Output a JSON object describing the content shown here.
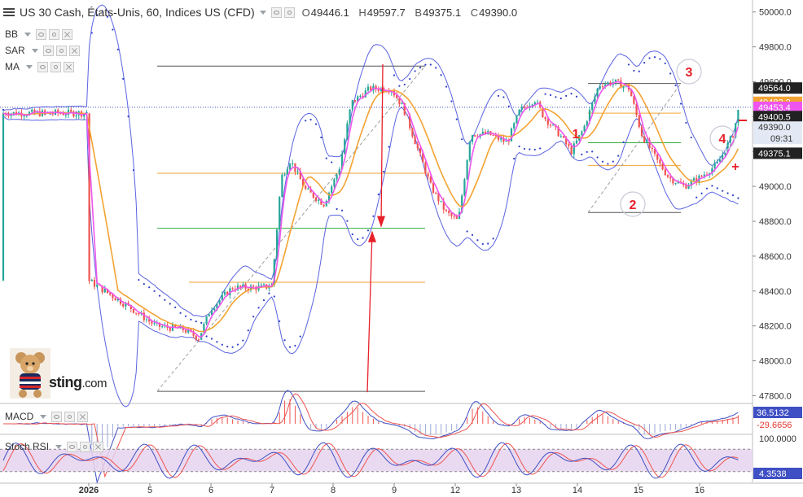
{
  "header": {
    "symbol_title": "US 30 Cash, États-Unis, 60, Indices US (CFD)",
    "ohlc": [
      {
        "key": "O",
        "value": "49446.1"
      },
      {
        "key": "H",
        "value": "49597.7"
      },
      {
        "key": "B",
        "value": "49375.1"
      },
      {
        "key": "C",
        "value": "49390.0"
      }
    ]
  },
  "indicators": {
    "bb": "BB",
    "sar": "SAR",
    "ma": "MA",
    "macd": "MACD",
    "stoch": "Stoch RSI"
  },
  "logo": {
    "text": "sting",
    "suffix": ".com"
  },
  "price_axis": {
    "ticks": [
      "50000.0",
      "49800.0",
      "49600.0",
      "49400.0",
      "49200.0",
      "49000.0",
      "48800.0",
      "48600.0",
      "48400.0",
      "48200.0",
      "48000.0",
      "47800.0"
    ],
    "badges": [
      {
        "label": "49564.0",
        "bg": "#222222",
        "fg": "#ffffff",
        "price": 49564.0
      },
      {
        "label": "49482.2",
        "bg": "#f3a333",
        "fg": "#ffffff",
        "price": 49482.2
      },
      {
        "label": "49453.4",
        "bg": "#ee55ee",
        "fg": "#ffffff",
        "price": 49453.4
      },
      {
        "label": "49400.5",
        "bg": "#222222",
        "fg": "#ffffff",
        "price": 49400.5
      },
      {
        "label": "49390.0",
        "bg": "#e3e9f4",
        "fg": "#333333",
        "price": 49340.0,
        "sub": "09:31"
      },
      {
        "label": "49375.1",
        "bg": "#222222",
        "fg": "#ffffff",
        "price": 49190.0
      }
    ]
  },
  "macd_axis": {
    "badges": [
      {
        "label": "36.5132",
        "bg": "#3f4fc4",
        "fg": "#ffffff"
      },
      {
        "label": "-29.6656",
        "bg": "#ffffff",
        "fg": "#e53935"
      }
    ]
  },
  "stoch_axis": {
    "ticks": [
      "100.0000"
    ],
    "badges": [
      {
        "label": "4.3538",
        "bg": "#3f4fc4",
        "fg": "#ffffff"
      }
    ]
  },
  "time_axis": {
    "labels": [
      "2026",
      "5",
      "6",
      "7",
      "8",
      "9",
      "12",
      "13",
      "14",
      "15",
      "16"
    ]
  },
  "annotations": {
    "wave_labels": [
      "1",
      "2",
      "3",
      "4"
    ]
  },
  "colors": {
    "bollinger": "#5b63e0",
    "sar": "#2b3dc8",
    "ma_fast": "#ee55ee",
    "ma_slow": "#f3a333",
    "bull_candle": "#26a69a",
    "bear_candle": "#ef5350",
    "annotation": "#e8202a",
    "stoch_band": "#e6d4ee"
  },
  "chart_data": {
    "type": "candlestick",
    "title": "US 30 Cash, États-Unis, 60, Indices US (CFD)",
    "ylim": [
      47760,
      50050
    ],
    "x": [
      "2026",
      "5",
      "6",
      "7",
      "8",
      "9",
      "12",
      "13",
      "14",
      "15",
      "16"
    ],
    "close_path": [
      [
        0,
        48460
      ],
      [
        0.35,
        48380
      ],
      [
        0.7,
        48300
      ],
      [
        1.1,
        48200
      ],
      [
        1.55,
        48180
      ],
      [
        1.8,
        48130
      ],
      [
        2.0,
        48300
      ],
      [
        2.35,
        48420
      ],
      [
        2.8,
        48420
      ],
      [
        3.0,
        48430
      ],
      [
        3.15,
        49050
      ],
      [
        3.3,
        49150
      ],
      [
        3.55,
        48980
      ],
      [
        3.85,
        48900
      ],
      [
        4.1,
        49100
      ],
      [
        4.3,
        49480
      ],
      [
        4.6,
        49560
      ],
      [
        4.95,
        49560
      ],
      [
        5.15,
        49450
      ],
      [
        5.35,
        49250
      ],
      [
        5.6,
        49000
      ],
      [
        5.85,
        48850
      ],
      [
        6.05,
        48800
      ],
      [
        6.25,
        49300
      ],
      [
        6.55,
        49300
      ],
      [
        6.85,
        49250
      ],
      [
        7.05,
        49430
      ],
      [
        7.3,
        49500
      ],
      [
        7.45,
        49400
      ],
      [
        7.7,
        49300
      ],
      [
        7.9,
        49200
      ],
      [
        8.1,
        49330
      ],
      [
        8.35,
        49580
      ],
      [
        8.6,
        49600
      ],
      [
        8.85,
        49560
      ],
      [
        9.05,
        49300
      ],
      [
        9.3,
        49150
      ],
      [
        9.5,
        49050
      ],
      [
        9.75,
        49000
      ],
      [
        10.0,
        49050
      ],
      [
        10.3,
        49130
      ],
      [
        10.55,
        49300
      ],
      [
        10.7,
        49540
      ],
      [
        10.95,
        49550
      ],
      [
        11.2,
        49500
      ],
      [
        11.4,
        49420
      ]
    ],
    "levels": [
      {
        "price": 49690,
        "color": "#555555"
      },
      {
        "price": 49075,
        "color": "#f3a333"
      },
      {
        "price": 48760,
        "color": "#2eaa3a"
      },
      {
        "price": 48450,
        "color": "#f3a333"
      },
      {
        "price": 47825,
        "color": "#555555"
      },
      {
        "price": 49590,
        "color": "#555555"
      },
      {
        "price": 49420,
        "color": "#f3a333"
      },
      {
        "price": 49250,
        "color": "#2eaa3a"
      },
      {
        "price": 49120,
        "color": "#f3a333"
      },
      {
        "price": 48850,
        "color": "#555555"
      }
    ],
    "last_price": 49453.4,
    "price_ticks": [
      50000,
      49800,
      49600,
      49400,
      49200,
      49000,
      48800,
      48600,
      48400,
      48200,
      48000,
      47800
    ],
    "macd_last": 36.5132,
    "macd_signal_last": -29.6656,
    "stoch_rsi_last": 4.3538,
    "stoch_rsi_ylim": [
      0,
      100
    ]
  }
}
